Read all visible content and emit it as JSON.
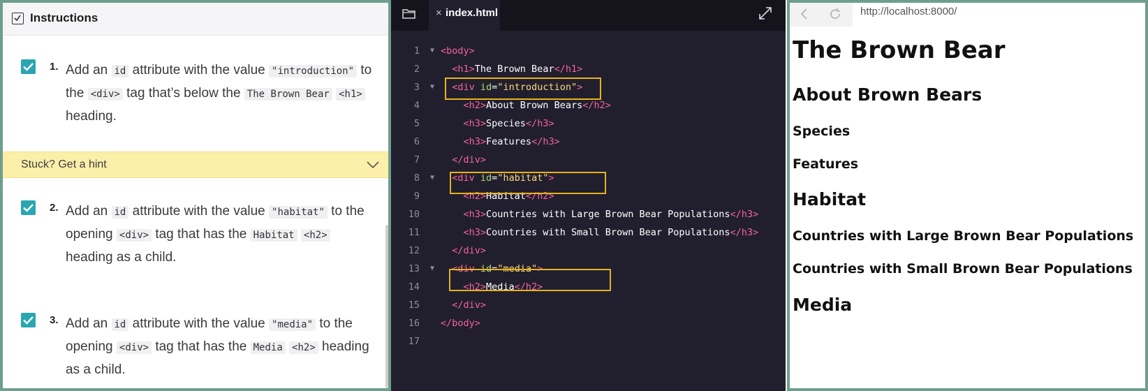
{
  "instructions": {
    "header_title": "Instructions",
    "hint_label": "Stuck? Get a hint",
    "tasks": [
      {
        "number": "1.",
        "t1": "Add an ",
        "c1": "id",
        "t2": " attribute with the value ",
        "c2": "\"introduction\"",
        "t3": " to the ",
        "c3": "<div>",
        "t4": " tag that’s below the ",
        "c4": "The Brown Bear",
        "t5": " ",
        "c5": "<h1>",
        "t6": " heading."
      },
      {
        "number": "2.",
        "t1": "Add an ",
        "c1": "id",
        "t2": " attribute with the value ",
        "c2": "\"habitat\"",
        "t3": " to the opening ",
        "c3": "<div>",
        "t4": " tag that has the ",
        "c4": "Habitat",
        "t5": " ",
        "c5": "<h2>",
        "t6": " heading as a child."
      },
      {
        "number": "3.",
        "t1": "Add an ",
        "c1": "id",
        "t2": " attribute with the value ",
        "c2": "\"media\"",
        "t3": " to the opening ",
        "c3": "<div>",
        "t4": " tag that has the ",
        "c4": "Media",
        "t5": " ",
        "c5": "<h2>",
        "t6": " heading as a child."
      }
    ]
  },
  "editor": {
    "file_name": "index.html",
    "lines": [
      {
        "n": "1",
        "fold": true,
        "indent": "",
        "parts": [
          [
            "tag",
            "<body>"
          ]
        ]
      },
      {
        "n": "2",
        "fold": false,
        "indent": "  ",
        "parts": [
          [
            "tag",
            "<h1>"
          ],
          [
            "txt",
            "The Brown Bear"
          ],
          [
            "tag",
            "</h1>"
          ]
        ]
      },
      {
        "n": "3",
        "fold": true,
        "indent": "  ",
        "parts": [
          [
            "tag",
            "<div "
          ],
          [
            "attr",
            "id"
          ],
          [
            "txt",
            "="
          ],
          [
            "str",
            "\"introduction\""
          ],
          [
            "tag",
            ">"
          ]
        ]
      },
      {
        "n": "4",
        "fold": false,
        "indent": "    ",
        "parts": [
          [
            "tag",
            "<h2>"
          ],
          [
            "txt",
            "About Brown Bears"
          ],
          [
            "tag",
            "</h2>"
          ]
        ]
      },
      {
        "n": "5",
        "fold": false,
        "indent": "    ",
        "parts": [
          [
            "tag",
            "<h3>"
          ],
          [
            "txt",
            "Species"
          ],
          [
            "tag",
            "</h3>"
          ]
        ]
      },
      {
        "n": "6",
        "fold": false,
        "indent": "    ",
        "parts": [
          [
            "tag",
            "<h3>"
          ],
          [
            "txt",
            "Features"
          ],
          [
            "tag",
            "</h3>"
          ]
        ]
      },
      {
        "n": "7",
        "fold": false,
        "indent": "  ",
        "parts": [
          [
            "tag",
            "</div>"
          ]
        ]
      },
      {
        "n": "8",
        "fold": true,
        "indent": "  ",
        "parts": [
          [
            "tag",
            "<div "
          ],
          [
            "attr",
            "id"
          ],
          [
            "txt",
            "="
          ],
          [
            "str",
            "\"habitat\""
          ],
          [
            "tag",
            ">"
          ]
        ]
      },
      {
        "n": "9",
        "fold": false,
        "indent": "    ",
        "parts": [
          [
            "tag",
            "<h2>"
          ],
          [
            "txt",
            "Habitat"
          ],
          [
            "tag",
            "</h2>"
          ]
        ]
      },
      {
        "n": "10",
        "fold": false,
        "indent": "    ",
        "parts": [
          [
            "tag",
            "<h3>"
          ],
          [
            "txt",
            "Countries with Large Brown Bear Populations"
          ],
          [
            "tag",
            "</h3>"
          ]
        ]
      },
      {
        "n": "11",
        "fold": false,
        "indent": "    ",
        "parts": [
          [
            "tag",
            "<h3>"
          ],
          [
            "txt",
            "Countries with Small Brown Bear Populations"
          ],
          [
            "tag",
            "</h3>"
          ]
        ]
      },
      {
        "n": "12",
        "fold": false,
        "indent": "  ",
        "parts": [
          [
            "tag",
            "</div>"
          ]
        ]
      },
      {
        "n": "13",
        "fold": true,
        "indent": "  ",
        "parts": [
          [
            "tag",
            "<div "
          ],
          [
            "attr",
            "id"
          ],
          [
            "txt",
            "="
          ],
          [
            "str",
            "\"media\""
          ],
          [
            "tag",
            ">"
          ]
        ]
      },
      {
        "n": "14",
        "fold": false,
        "indent": "    ",
        "parts": [
          [
            "tag",
            "<h2>"
          ],
          [
            "txt",
            "Media"
          ],
          [
            "tag",
            "</h2>"
          ]
        ]
      },
      {
        "n": "15",
        "fold": false,
        "indent": "  ",
        "parts": [
          [
            "tag",
            "</div>"
          ]
        ]
      },
      {
        "n": "16",
        "fold": false,
        "indent": "",
        "parts": [
          [
            "tag",
            "</body>"
          ]
        ]
      },
      {
        "n": "17",
        "fold": false,
        "indent": "",
        "parts": []
      }
    ]
  },
  "preview": {
    "url": "http://localhost:8000/",
    "h1": "The Brown Bear",
    "about": "About Brown Bears",
    "species": "Species",
    "features": "Features",
    "habitat": "Habitat",
    "large": "Countries with Large Brown Bear Populations",
    "small": "Countries with Small Brown Bear Populations",
    "media": "Media"
  },
  "colors": {
    "panel_border": "#6f9e8c",
    "checkbox": "#2aa6b2",
    "hint_bg": "#fcefaa",
    "editor_bg": "#211f2e",
    "tag": "#f4639c",
    "attr": "#a9dc76",
    "string": "#ffd97a",
    "highlight": "#e7b21b"
  },
  "icons": {
    "header_checkbox": "checkbox-icon",
    "task_check": "checkmark-icon",
    "hint_chevron": "chevron-down-icon",
    "folder": "folder-icon",
    "close": "close-icon",
    "expand": "expand-icon",
    "back": "back-arrow-icon",
    "reload": "reload-icon"
  }
}
